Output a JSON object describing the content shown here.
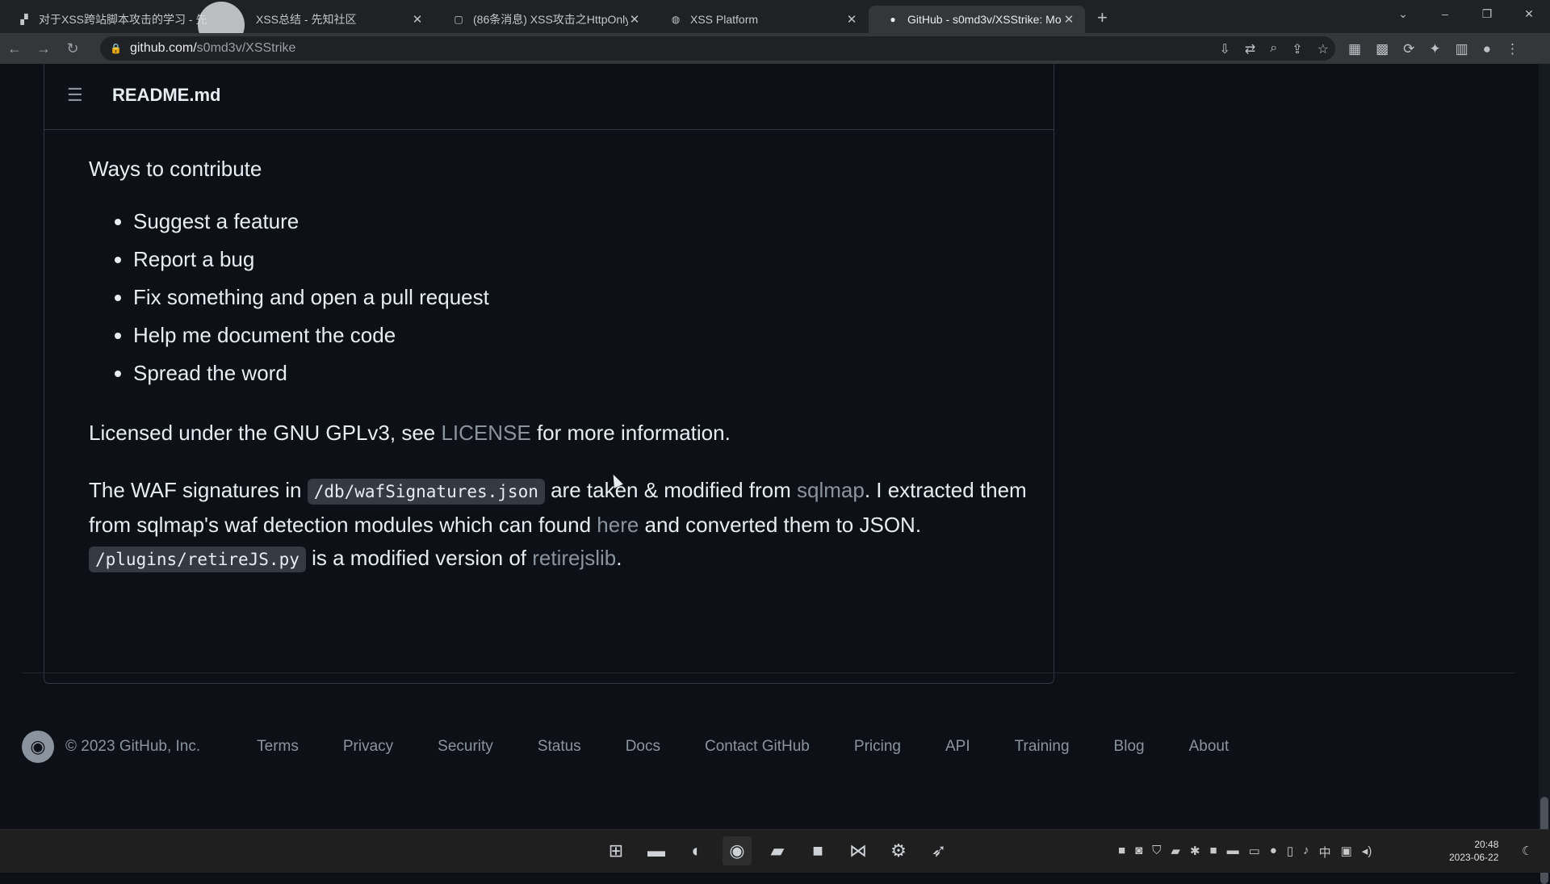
{
  "browser": {
    "tabs": [
      {
        "title": "对于XSS跨站脚本攻击的学习 - 先",
        "favicon": "doc-icon"
      },
      {
        "title": "XSS总结 - 先知社区",
        "favicon": "page-icon"
      },
      {
        "title": "(86条消息) XSS攻击之HttpOnly",
        "favicon": "doc-icon"
      },
      {
        "title": "XSS Platform",
        "favicon": "globe-icon"
      },
      {
        "title": "GitHub - s0md3v/XSStrike: Mo",
        "favicon": "github-icon",
        "active": true
      }
    ],
    "url_host": "github.com/",
    "url_path": "s0md3v/XSStrike"
  },
  "readme": {
    "title": "README.md",
    "ways_heading": "Ways to contribute",
    "contribute_items": [
      "Suggest a feature",
      "Report a bug",
      "Fix something and open a pull request",
      "Help me document the code",
      "Spread the word"
    ],
    "license_pre": "Licensed under the GNU GPLv3, see ",
    "license_link": "LICENSE",
    "license_post": " for more information.",
    "waf_pre": "The WAF signatures in ",
    "waf_code": "/db/wafSignatures.json",
    "waf_mid1": " are taken & modified from ",
    "waf_link_sqlmap": "sqlmap",
    "waf_mid2": ". I extracted them from sqlmap's waf detection modules which can found ",
    "waf_link_here": "here",
    "waf_mid3": " and converted them to JSON. ",
    "plugin_code": "/plugins/retireJS.py",
    "plugin_mid": " is a modified version of ",
    "plugin_link": "retirejslib",
    "plugin_post": "."
  },
  "footer": {
    "copyright": "© 2023 GitHub, Inc.",
    "links": [
      "Terms",
      "Privacy",
      "Security",
      "Status",
      "Docs",
      "Contact GitHub",
      "Pricing",
      "API",
      "Training",
      "Blog",
      "About"
    ]
  },
  "taskbar": {
    "time": "20:48",
    "date": "2023-06-22",
    "ime": "中"
  }
}
